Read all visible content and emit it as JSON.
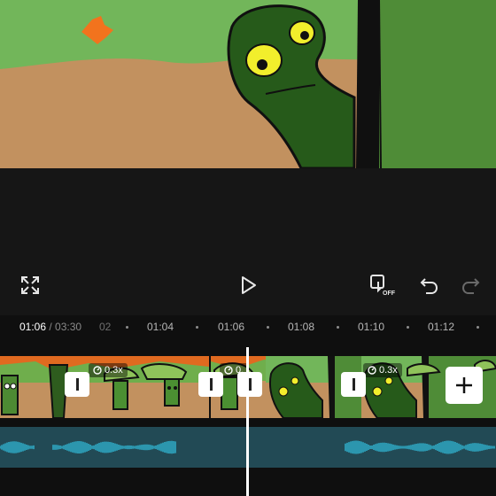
{
  "timeline": {
    "current_time": "01:06",
    "separator": " / ",
    "total_time": "03:30",
    "ticks": [
      "02",
      "01:04",
      "01:06",
      "01:08",
      "01:10",
      "01:12"
    ]
  },
  "clips": [
    {
      "speed": "0.3x"
    },
    {
      "speed": "0."
    },
    {
      "speed": "0.3x"
    }
  ],
  "colors": {
    "background": "#121212",
    "audio_track": "#224a55",
    "waveform": "#2fa9c4",
    "playhead": "#ffffff"
  },
  "icons": {
    "fullscreen": "fullscreen-icon",
    "play": "play-icon",
    "keyframe_off": "keyframe-off-icon",
    "undo": "undo-icon",
    "redo": "redo-icon",
    "add": "add-icon",
    "speed": "speed-icon"
  },
  "toolbar": {
    "keyframe_badge": "OFF"
  }
}
